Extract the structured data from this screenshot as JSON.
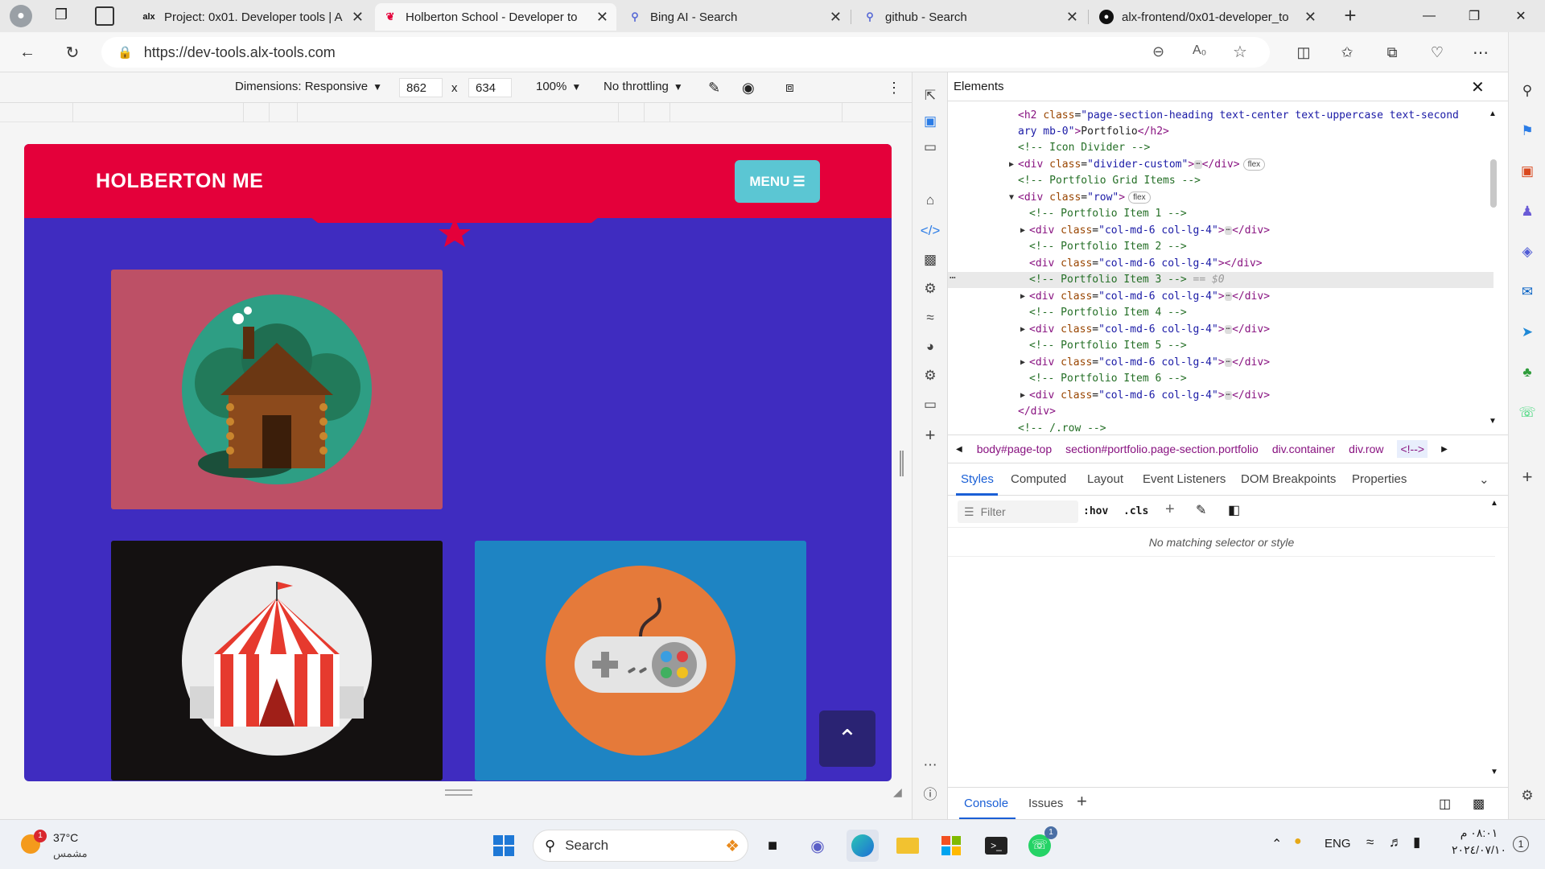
{
  "browser": {
    "tabs": [
      {
        "title": "Project: 0x01. Developer tools | A",
        "favicon": "alx"
      },
      {
        "title": "Holberton School - Developer to",
        "favicon": "holberton-logo"
      },
      {
        "title": "Bing AI - Search",
        "favicon": "search-icon"
      },
      {
        "title": "github - Search",
        "favicon": "search-icon"
      },
      {
        "title": "alx-frontend/0x01-developer_to",
        "favicon": "github-logo"
      }
    ],
    "url": "https://dev-tools.alx-tools.com"
  },
  "emulation": {
    "dimensions_label": "Dimensions: Responsive",
    "width": "862",
    "times": "x",
    "height": "634",
    "zoom": "100%",
    "throttling": "No throttling"
  },
  "site": {
    "brand": "HOLBERTON ME",
    "menu_label": "MENU",
    "tile_colors": [
      "#bd5066",
      "#141111",
      "#1e84c3"
    ],
    "scroll_top_icon": "chevron-up-icon"
  },
  "devtools": {
    "panel_title": "Elements",
    "dom": {
      "line0_attr": "page-section-heading text-center text-uppercase text-second",
      "line1_wrap": "ary mb-0",
      "line1_text": "Portfolio",
      "c_icon_divider": "<!-- Icon Divider -->",
      "divider_class": "divider-custom",
      "flex_badge": "flex",
      "c_grid_items": "<!-- Portfolio Grid Items -->",
      "row_class": "row",
      "col_class": "col-md-6 col-lg-4",
      "c_item1": "<!-- Portfolio Item 1 -->",
      "c_item2": "<!-- Portfolio Item 2 -->",
      "c_item3": "<!-- Portfolio Item 3 -->",
      "selected_marker": "== $0",
      "c_item4": "<!-- Portfolio Item 4 -->",
      "c_item5": "<!-- Portfolio Item 5 -->",
      "c_item6": "<!-- Portfolio Item 6 -->",
      "close_div": "</div>",
      "c_row_end": "<!-- /.row -->"
    },
    "breadcrumbs": [
      "body#page-top",
      "section#portfolio.page-section.portfolio",
      "div.container",
      "div.row",
      "<!-->"
    ],
    "style_tabs": [
      "Styles",
      "Computed",
      "Layout",
      "Event Listeners",
      "DOM Breakpoints",
      "Properties"
    ],
    "filter_placeholder": "Filter",
    "hov": ":hov",
    "cls": ".cls",
    "no_match": "No matching selector or style",
    "drawer_tabs": [
      "Console",
      "Issues"
    ]
  },
  "taskbar": {
    "temperature": "37°C",
    "weather_text": "مشمس",
    "weather_badge": "1",
    "search_label": "Search",
    "lang": "ENG",
    "time": "٠٨:٠١ م",
    "date": "٢٠٢٤/٠٧/١٠",
    "notif_count": "1",
    "whatsapp_badge": "1"
  }
}
